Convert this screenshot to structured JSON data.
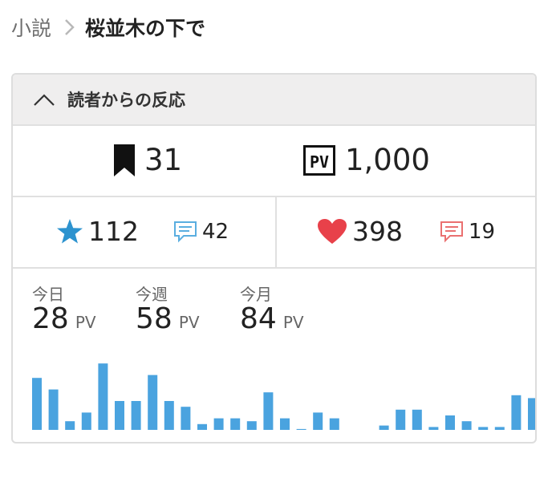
{
  "breadcrumb": {
    "root": "小説",
    "current": "桜並木の下で"
  },
  "panel": {
    "title": "読者からの反応",
    "bookmark_count": "31",
    "pv_badge": "PV",
    "pv_total": "1,000",
    "star_count": "112",
    "star_comment_count": "42",
    "heart_count": "398",
    "heart_comment_count": "19"
  },
  "stats": {
    "unit": "PV",
    "today_label": "今日",
    "today_value": "28",
    "week_label": "今週",
    "week_value": "58",
    "month_label": "今月",
    "month_value": "84"
  },
  "colors": {
    "bar": "#4aa3df",
    "star": "#2d93cf",
    "heart": "#e8414a",
    "comment_blue": "#5aaee0",
    "comment_red": "#ea7070"
  },
  "chart_data": {
    "type": "bar",
    "values": [
      18,
      14,
      3,
      6,
      23,
      10,
      10,
      19,
      10,
      8,
      2,
      4,
      4,
      3,
      13,
      4,
      0.3,
      6,
      4,
      0,
      0,
      1.5,
      7,
      7,
      1,
      5,
      3,
      1,
      1,
      12,
      11
    ],
    "ylim": [
      0,
      25
    ]
  }
}
